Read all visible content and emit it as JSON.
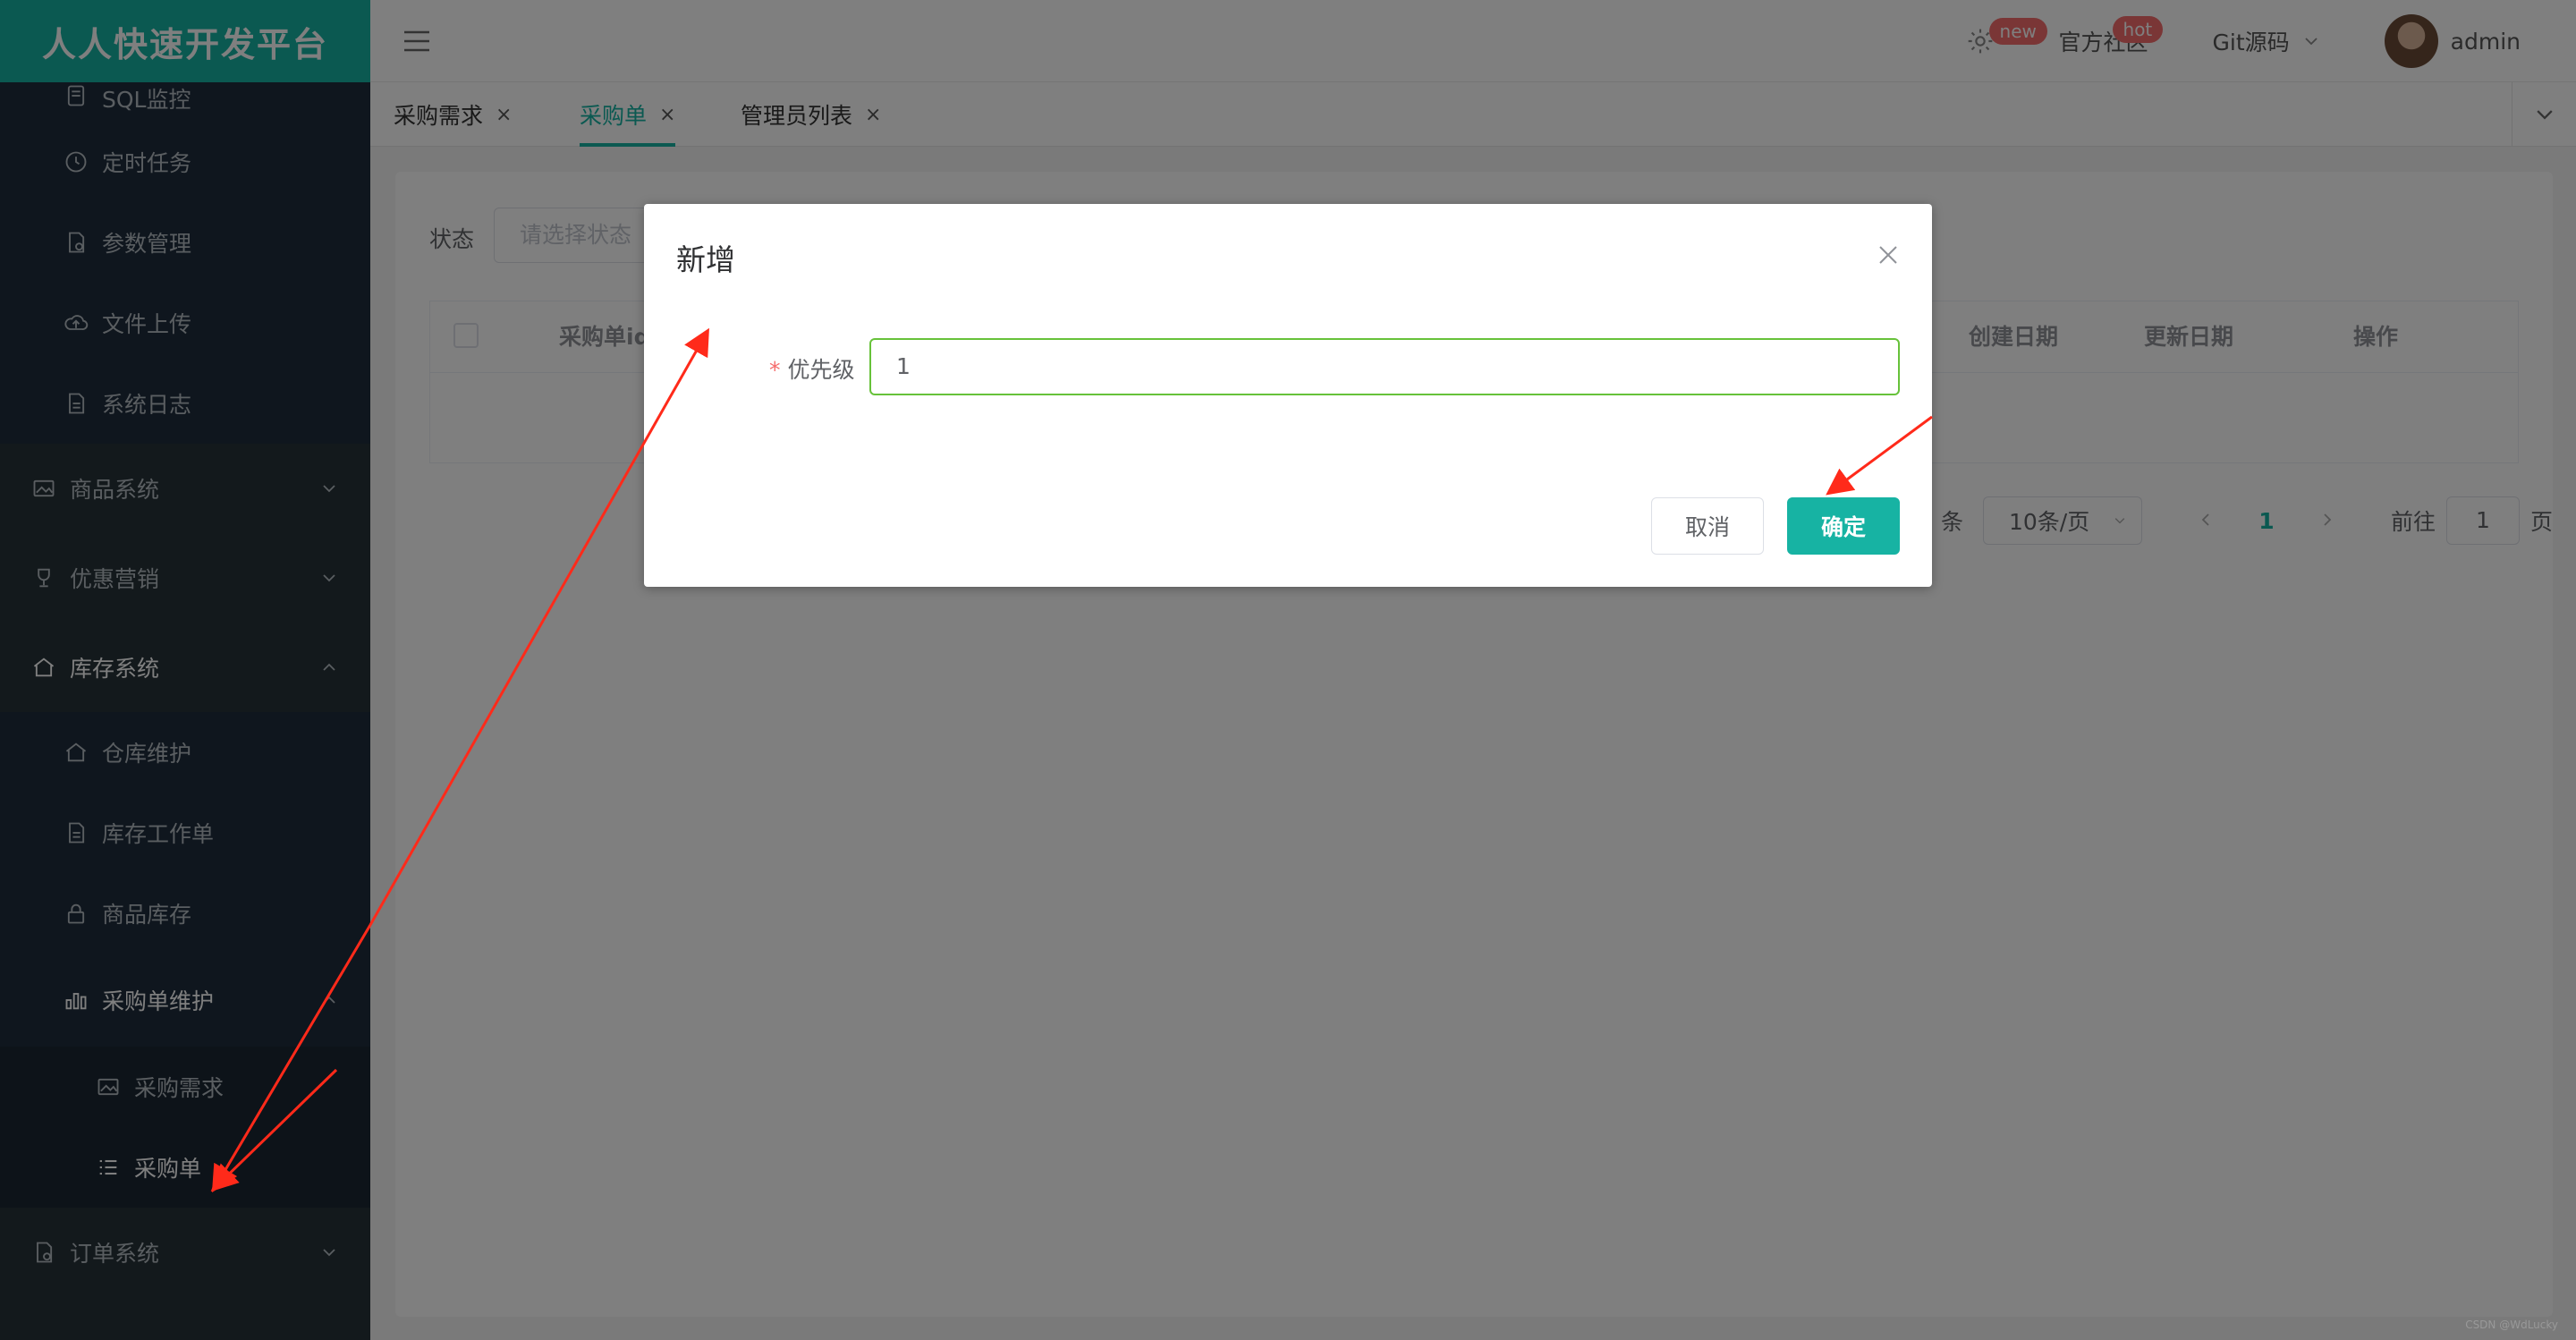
{
  "brand": "人人快速开发平台",
  "sidebar": {
    "items": [
      {
        "label": "SQL监控"
      },
      {
        "label": "定时任务"
      },
      {
        "label": "参数管理"
      },
      {
        "label": "文件上传"
      },
      {
        "label": "系统日志"
      },
      {
        "label": "商品系统"
      },
      {
        "label": "优惠营销"
      },
      {
        "label": "库存系统"
      },
      {
        "label": "仓库维护"
      },
      {
        "label": "库存工作单"
      },
      {
        "label": "商品库存"
      },
      {
        "label": "采购单维护"
      },
      {
        "label": "采购需求"
      },
      {
        "label": "采购单"
      },
      {
        "label": "订单系统"
      }
    ]
  },
  "header": {
    "settings_badge": "new",
    "community_label": "官方社区",
    "community_badge": "hot",
    "git_label": "Git源码",
    "user_name": "admin"
  },
  "tabs": [
    {
      "label": "采购需求",
      "close": "×"
    },
    {
      "label": "采购单",
      "close": "×"
    },
    {
      "label": "管理员列表",
      "close": "×"
    }
  ],
  "filter": {
    "label": "状态",
    "placeholder": "请选择状态"
  },
  "table": {
    "columns": {
      "id": "采购单id",
      "created": "创建日期",
      "updated": "更新日期",
      "actions": "操作"
    }
  },
  "pager": {
    "total_suffix": "条",
    "page_size": "10条/页",
    "current_page": "1",
    "goto_prefix": "前往",
    "goto_value": "1",
    "goto_suffix": "页"
  },
  "modal": {
    "title": "新增",
    "field_required": "*",
    "field_label": "优先级",
    "field_value": "1",
    "cancel_label": "取消",
    "ok_label": "确定"
  },
  "watermark": "CSDN @WdLucky",
  "colors": {
    "brand": "#17b3a3",
    "sidebar": "#263238",
    "required": "#f56c6c",
    "valid_border": "#67c23a",
    "annotation": "#ff2a1a"
  }
}
